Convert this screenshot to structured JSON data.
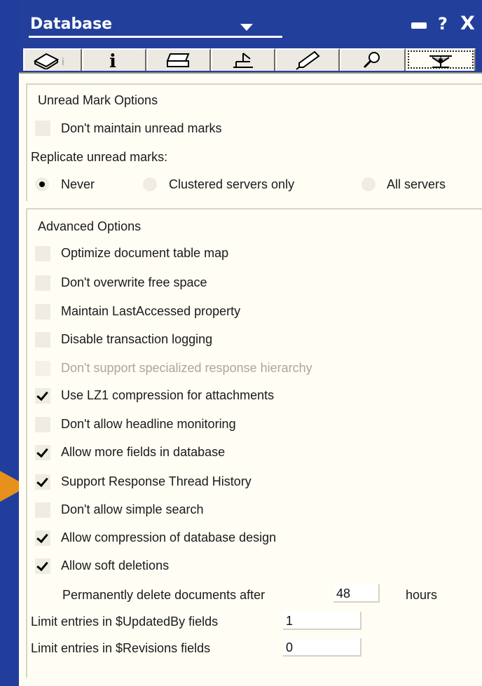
{
  "window": {
    "title": "Database",
    "help_symbol": "?",
    "close_symbol": "X"
  },
  "tabs": [
    {
      "icon": "info-sheet-icon",
      "active": false
    },
    {
      "icon": "info-icon",
      "active": false
    },
    {
      "icon": "printer-icon",
      "active": false
    },
    {
      "icon": "design-icon",
      "active": false
    },
    {
      "icon": "launch-icon",
      "active": false
    },
    {
      "icon": "search-icon",
      "active": false
    },
    {
      "icon": "advanced-propeller-icon",
      "active": true
    }
  ],
  "unread": {
    "heading": "Unread Mark Options",
    "dont_maintain": {
      "label": "Don't maintain unread marks",
      "checked": false
    },
    "replicate_label": "Replicate unread marks:",
    "options": [
      {
        "label": "Never",
        "selected": true
      },
      {
        "label": "Clustered servers only",
        "selected": false
      },
      {
        "label": "All servers",
        "selected": false
      }
    ]
  },
  "advanced": {
    "heading": "Advanced Options",
    "options": [
      {
        "label": "Optimize document table map",
        "checked": false,
        "enabled": true
      },
      {
        "label": "Don't overwrite free space",
        "checked": false,
        "enabled": true
      },
      {
        "label": "Maintain LastAccessed property",
        "checked": false,
        "enabled": true
      },
      {
        "label": "Disable transaction logging",
        "checked": false,
        "enabled": true
      },
      {
        "label": "Don't support specialized response hierarchy",
        "checked": false,
        "enabled": false
      },
      {
        "label": "Use LZ1 compression for attachments",
        "checked": true,
        "enabled": true
      },
      {
        "label": "Don't allow headline monitoring",
        "checked": false,
        "enabled": true
      },
      {
        "label": "Allow more fields in database",
        "checked": true,
        "enabled": true
      },
      {
        "label": "Support Response Thread History",
        "checked": true,
        "enabled": true
      },
      {
        "label": "Don't allow simple search",
        "checked": false,
        "enabled": true
      },
      {
        "label": "Allow compression of database design",
        "checked": true,
        "enabled": true
      },
      {
        "label": "Allow soft deletions",
        "checked": true,
        "enabled": true
      }
    ],
    "delete_after": {
      "label": "Permanently delete documents after",
      "value": "48",
      "unit": "hours"
    },
    "updated_by": {
      "label": "Limit entries in $UpdatedBy fields",
      "value": "1"
    },
    "revisions": {
      "label": "Limit entries in $Revisions fields",
      "value": "0"
    }
  },
  "colors": {
    "title_bar": "#233f9c",
    "panel_bg": "#fffdf4",
    "pointer_arrow": "#e8901c"
  }
}
